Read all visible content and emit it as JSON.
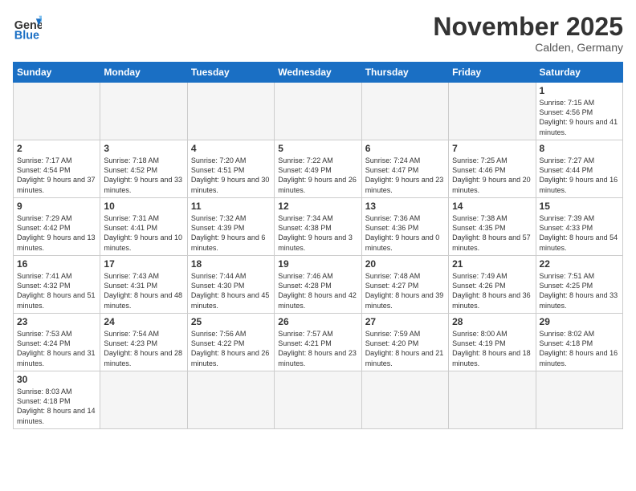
{
  "logo": {
    "text_general": "General",
    "text_blue": "Blue"
  },
  "title": "November 2025",
  "subtitle": "Calden, Germany",
  "weekdays": [
    "Sunday",
    "Monday",
    "Tuesday",
    "Wednesday",
    "Thursday",
    "Friday",
    "Saturday"
  ],
  "weeks": [
    [
      {
        "day": "",
        "info": ""
      },
      {
        "day": "",
        "info": ""
      },
      {
        "day": "",
        "info": ""
      },
      {
        "day": "",
        "info": ""
      },
      {
        "day": "",
        "info": ""
      },
      {
        "day": "",
        "info": ""
      },
      {
        "day": "1",
        "info": "Sunrise: 7:15 AM\nSunset: 4:56 PM\nDaylight: 9 hours and 41 minutes."
      }
    ],
    [
      {
        "day": "2",
        "info": "Sunrise: 7:17 AM\nSunset: 4:54 PM\nDaylight: 9 hours and 37 minutes."
      },
      {
        "day": "3",
        "info": "Sunrise: 7:18 AM\nSunset: 4:52 PM\nDaylight: 9 hours and 33 minutes."
      },
      {
        "day": "4",
        "info": "Sunrise: 7:20 AM\nSunset: 4:51 PM\nDaylight: 9 hours and 30 minutes."
      },
      {
        "day": "5",
        "info": "Sunrise: 7:22 AM\nSunset: 4:49 PM\nDaylight: 9 hours and 26 minutes."
      },
      {
        "day": "6",
        "info": "Sunrise: 7:24 AM\nSunset: 4:47 PM\nDaylight: 9 hours and 23 minutes."
      },
      {
        "day": "7",
        "info": "Sunrise: 7:25 AM\nSunset: 4:46 PM\nDaylight: 9 hours and 20 minutes."
      },
      {
        "day": "8",
        "info": "Sunrise: 7:27 AM\nSunset: 4:44 PM\nDaylight: 9 hours and 16 minutes."
      }
    ],
    [
      {
        "day": "9",
        "info": "Sunrise: 7:29 AM\nSunset: 4:42 PM\nDaylight: 9 hours and 13 minutes."
      },
      {
        "day": "10",
        "info": "Sunrise: 7:31 AM\nSunset: 4:41 PM\nDaylight: 9 hours and 10 minutes."
      },
      {
        "day": "11",
        "info": "Sunrise: 7:32 AM\nSunset: 4:39 PM\nDaylight: 9 hours and 6 minutes."
      },
      {
        "day": "12",
        "info": "Sunrise: 7:34 AM\nSunset: 4:38 PM\nDaylight: 9 hours and 3 minutes."
      },
      {
        "day": "13",
        "info": "Sunrise: 7:36 AM\nSunset: 4:36 PM\nDaylight: 9 hours and 0 minutes."
      },
      {
        "day": "14",
        "info": "Sunrise: 7:38 AM\nSunset: 4:35 PM\nDaylight: 8 hours and 57 minutes."
      },
      {
        "day": "15",
        "info": "Sunrise: 7:39 AM\nSunset: 4:33 PM\nDaylight: 8 hours and 54 minutes."
      }
    ],
    [
      {
        "day": "16",
        "info": "Sunrise: 7:41 AM\nSunset: 4:32 PM\nDaylight: 8 hours and 51 minutes."
      },
      {
        "day": "17",
        "info": "Sunrise: 7:43 AM\nSunset: 4:31 PM\nDaylight: 8 hours and 48 minutes."
      },
      {
        "day": "18",
        "info": "Sunrise: 7:44 AM\nSunset: 4:30 PM\nDaylight: 8 hours and 45 minutes."
      },
      {
        "day": "19",
        "info": "Sunrise: 7:46 AM\nSunset: 4:28 PM\nDaylight: 8 hours and 42 minutes."
      },
      {
        "day": "20",
        "info": "Sunrise: 7:48 AM\nSunset: 4:27 PM\nDaylight: 8 hours and 39 minutes."
      },
      {
        "day": "21",
        "info": "Sunrise: 7:49 AM\nSunset: 4:26 PM\nDaylight: 8 hours and 36 minutes."
      },
      {
        "day": "22",
        "info": "Sunrise: 7:51 AM\nSunset: 4:25 PM\nDaylight: 8 hours and 33 minutes."
      }
    ],
    [
      {
        "day": "23",
        "info": "Sunrise: 7:53 AM\nSunset: 4:24 PM\nDaylight: 8 hours and 31 minutes."
      },
      {
        "day": "24",
        "info": "Sunrise: 7:54 AM\nSunset: 4:23 PM\nDaylight: 8 hours and 28 minutes."
      },
      {
        "day": "25",
        "info": "Sunrise: 7:56 AM\nSunset: 4:22 PM\nDaylight: 8 hours and 26 minutes."
      },
      {
        "day": "26",
        "info": "Sunrise: 7:57 AM\nSunset: 4:21 PM\nDaylight: 8 hours and 23 minutes."
      },
      {
        "day": "27",
        "info": "Sunrise: 7:59 AM\nSunset: 4:20 PM\nDaylight: 8 hours and 21 minutes."
      },
      {
        "day": "28",
        "info": "Sunrise: 8:00 AM\nSunset: 4:19 PM\nDaylight: 8 hours and 18 minutes."
      },
      {
        "day": "29",
        "info": "Sunrise: 8:02 AM\nSunset: 4:18 PM\nDaylight: 8 hours and 16 minutes."
      }
    ],
    [
      {
        "day": "30",
        "info": "Sunrise: 8:03 AM\nSunset: 4:18 PM\nDaylight: 8 hours and 14 minutes."
      },
      {
        "day": "",
        "info": ""
      },
      {
        "day": "",
        "info": ""
      },
      {
        "day": "",
        "info": ""
      },
      {
        "day": "",
        "info": ""
      },
      {
        "day": "",
        "info": ""
      },
      {
        "day": "",
        "info": ""
      }
    ]
  ]
}
